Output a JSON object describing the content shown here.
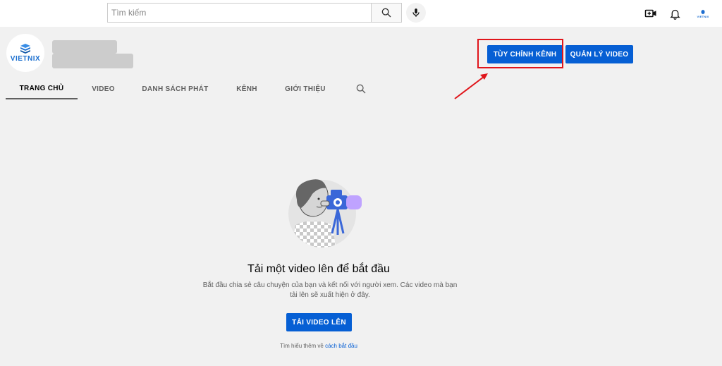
{
  "header": {
    "search_placeholder": "Tìm kiếm",
    "search_icon": "search-icon",
    "mic_icon": "mic-icon",
    "create_icon": "video-create-icon",
    "notifications_icon": "bell-icon",
    "account_avatar_text": "VIETNIX"
  },
  "channel": {
    "avatar_logo_text": "VIETNIX",
    "customize_label": "TÙY CHỈNH KÊNH",
    "manage_label": "QUẢN LÝ VIDEO"
  },
  "tabs": [
    {
      "label": "TRANG CHỦ",
      "active": true
    },
    {
      "label": "VIDEO",
      "active": false
    },
    {
      "label": "DANH SÁCH PHÁT",
      "active": false
    },
    {
      "label": "KÊNH",
      "active": false
    },
    {
      "label": "GIỚI THIỆU",
      "active": false
    }
  ],
  "empty_state": {
    "title": "Tải một video lên để bắt đầu",
    "description": "Bắt đầu chia sẻ câu chuyện của bạn và kết nối với người xem. Các video mà bạn tải lên sẽ xuất hiện ở đây.",
    "upload_label": "TẢI VIDEO LÊN",
    "learn_more_prefix": "Tìm hiểu thêm về",
    "learn_more_link": "cách bắt đầu"
  },
  "colors": {
    "primary": "#065fd4",
    "highlight": "#e0151b",
    "background": "#f1f1f1",
    "brand": "#1b6fcf"
  }
}
